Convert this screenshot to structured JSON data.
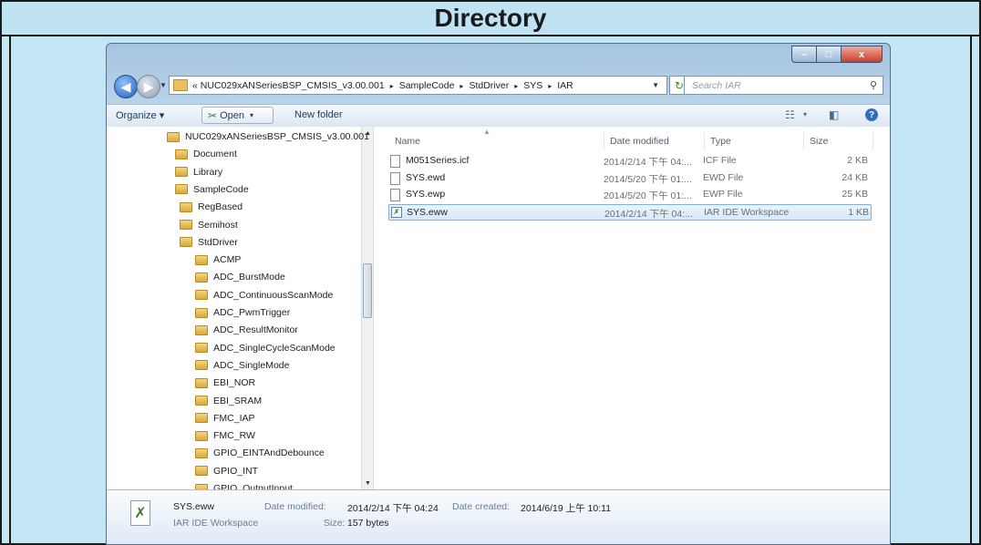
{
  "slide": {
    "title": "Directory"
  },
  "window": {
    "buttons": {
      "minimize": "–",
      "maximize": "□",
      "close": "x"
    },
    "address": {
      "prefix": "«",
      "crumbs": [
        "NUC029xANSeriesBSP_CMSIS_v3.00.001",
        "SampleCode",
        "StdDriver",
        "SYS",
        "IAR"
      ],
      "separator": "▸"
    },
    "search": {
      "placeholder": "Search IAR"
    },
    "toolbar": {
      "organize": "Organize ▾",
      "open": "Open",
      "open_dd": "▾",
      "new_folder": "New folder",
      "view_dd": "▾"
    },
    "tree": [
      {
        "label": "NUC029xANSeriesBSP_CMSIS_v3.00.001",
        "level": 0
      },
      {
        "label": "Document",
        "level": 1
      },
      {
        "label": "Library",
        "level": 1
      },
      {
        "label": "SampleCode",
        "level": 1
      },
      {
        "label": "RegBased",
        "level": 2
      },
      {
        "label": "Semihost",
        "level": 2
      },
      {
        "label": "StdDriver",
        "level": 2
      },
      {
        "label": "ACMP",
        "level": 3
      },
      {
        "label": "ADC_BurstMode",
        "level": 3
      },
      {
        "label": "ADC_ContinuousScanMode",
        "level": 3
      },
      {
        "label": "ADC_PwmTrigger",
        "level": 3
      },
      {
        "label": "ADC_ResultMonitor",
        "level": 3
      },
      {
        "label": "ADC_SingleCycleScanMode",
        "level": 3
      },
      {
        "label": "ADC_SingleMode",
        "level": 3
      },
      {
        "label": "EBI_NOR",
        "level": 3
      },
      {
        "label": "EBI_SRAM",
        "level": 3
      },
      {
        "label": "FMC_IAP",
        "level": 3
      },
      {
        "label": "FMC_RW",
        "level": 3
      },
      {
        "label": "GPIO_EINTAndDebounce",
        "level": 3
      },
      {
        "label": "GPIO_INT",
        "level": 3
      },
      {
        "label": "GPIO_OutputInput",
        "level": 3
      }
    ],
    "columns": {
      "name": "Name",
      "date": "Date modified",
      "type": "Type",
      "size": "Size"
    },
    "files": [
      {
        "name": "M051Series.icf",
        "date": "2014/2/14 下午 04:...",
        "type": "ICF File",
        "size": "2 KB",
        "selected": false,
        "icon": "document-icon"
      },
      {
        "name": "SYS.ewd",
        "date": "2014/5/20 下午 01:...",
        "type": "EWD File",
        "size": "24 KB",
        "selected": false,
        "icon": "document-icon"
      },
      {
        "name": "SYS.ewp",
        "date": "2014/5/20 下午 01:...",
        "type": "EWP File",
        "size": "25 KB",
        "selected": false,
        "icon": "document-icon"
      },
      {
        "name": "SYS.eww",
        "date": "2014/2/14 下午 04:...",
        "type": "IAR IDE Workspace",
        "size": "1 KB",
        "selected": true,
        "icon": "workspace-icon"
      }
    ],
    "details": {
      "filename": "SYS.eww",
      "filetype": "IAR IDE Workspace",
      "modified_label": "Date modified:",
      "modified": "2014/2/14 下午 04:24",
      "created_label": "Date created:",
      "created": "2014/6/19 上午 10:11",
      "size_label": "Size:",
      "size": "157 bytes"
    },
    "colors": {
      "accent_selection": "#d6e9fa",
      "slide_background": "#c3e6f4",
      "folder": "#e8c15a"
    }
  }
}
